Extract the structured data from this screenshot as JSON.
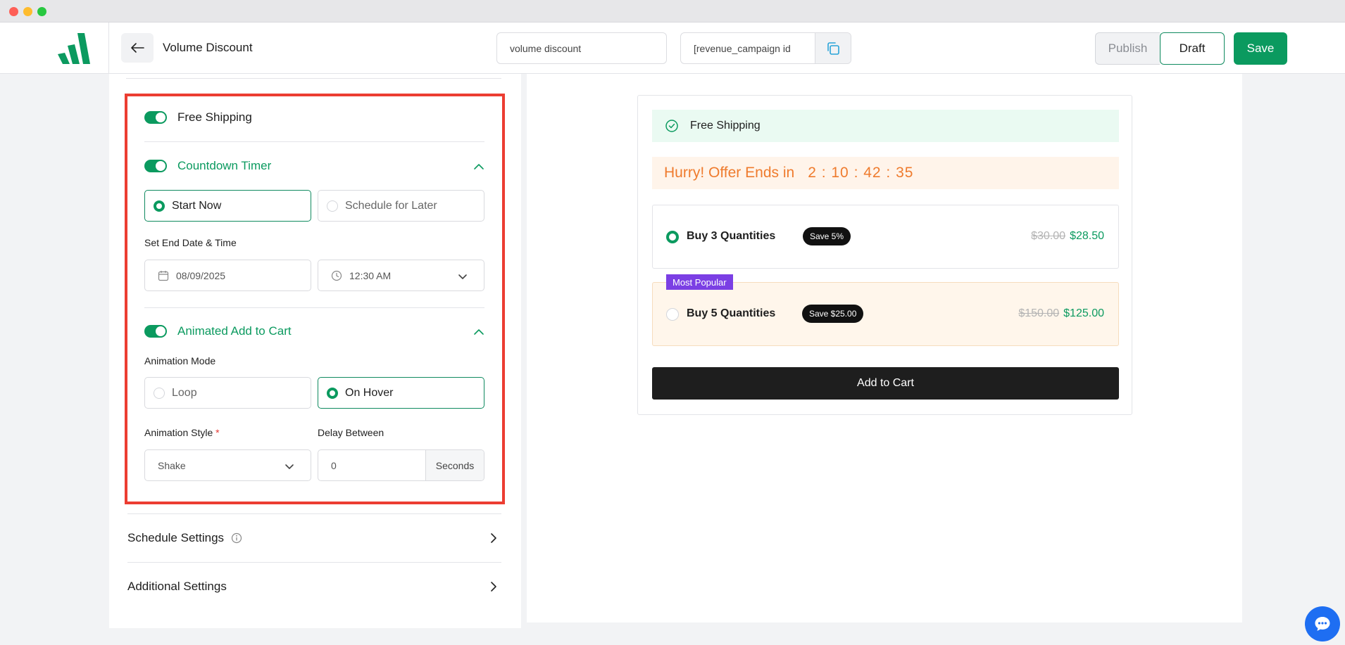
{
  "header": {
    "page_title": "Volume Discount",
    "campaign_name_value": "volume discount",
    "shortcode_value": "[revenue_campaign id='",
    "publish_label": "Publish",
    "draft_label": "Draft",
    "save_label": "Save"
  },
  "settings": {
    "free_shipping_label": "Free Shipping",
    "countdown": {
      "label": "Countdown Timer",
      "start_now_label": "Start Now",
      "schedule_later_label": "Schedule for Later",
      "end_label": "Set End Date & Time",
      "date_value": "08/09/2025",
      "time_value": "12:30 AM"
    },
    "animated_cart": {
      "label": "Animated Add to Cart",
      "mode_label": "Animation Mode",
      "loop_label": "Loop",
      "hover_label": "On Hover",
      "style_label": "Animation Style",
      "required_mark": "*",
      "style_value": "Shake",
      "delay_label": "Delay Between",
      "delay_value": "0",
      "delay_unit": "Seconds"
    },
    "schedule_settings_label": "Schedule Settings",
    "additional_settings_label": "Additional Settings"
  },
  "preview": {
    "free_shipping": "Free Shipping",
    "timer_text": "Hurry! Offer Ends in",
    "timer_value": "2 : 10 : 42 : 35",
    "tiers": [
      {
        "title": "Buy 3 Quantities",
        "badge": "Save 5%",
        "old_price": "$30.00",
        "new_price": "$28.50"
      },
      {
        "title": "Buy 5 Quantities",
        "badge": "Save $25.00",
        "old_price": "$150.00",
        "new_price": "$125.00",
        "tag": "Most Popular"
      }
    ],
    "add_to_cart": "Add to Cart"
  },
  "colors": {
    "brand_green": "#0b9a5f",
    "highlight_red": "#ec3d32",
    "timer_orange": "#ef7b2d",
    "popular_purple": "#7b3fe4"
  },
  "icons": [
    "logo-icon",
    "back-arrow-icon",
    "copy-icon",
    "chevron-up-icon",
    "calendar-icon",
    "clock-icon",
    "chevron-down-icon",
    "info-icon",
    "chevron-right-icon",
    "check-circle-icon",
    "chat-icon"
  ]
}
